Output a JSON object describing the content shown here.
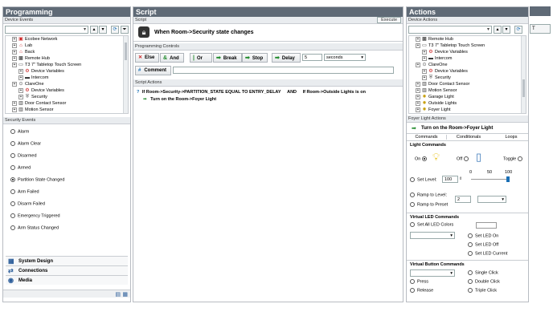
{
  "left": {
    "title": "Programming",
    "device_events_header": "Device Events",
    "tree": [
      {
        "label": "Ecobee Network",
        "icon": "network-icon",
        "depth": 1
      },
      {
        "label": "Lab",
        "icon": "room-icon",
        "depth": 1
      },
      {
        "label": "Back",
        "icon": "room-icon",
        "depth": 1
      },
      {
        "label": "Remote Hub",
        "icon": "remote-icon",
        "depth": 1
      },
      {
        "label": "T3 7\" Tabletop Touch Screen",
        "icon": "touchscreen-icon",
        "depth": 1
      },
      {
        "label": "Device Variables",
        "icon": "variables-icon",
        "depth": 2
      },
      {
        "label": "Intercom",
        "icon": "intercom-icon",
        "depth": 2
      },
      {
        "label": "ClareOne",
        "icon": "lock-icon",
        "depth": 1
      },
      {
        "label": "Device Variables",
        "icon": "variables-icon",
        "depth": 2
      },
      {
        "label": "Security",
        "icon": "security-icon",
        "depth": 2
      },
      {
        "label": "Door Contact Sensor",
        "icon": "sensor-icon",
        "depth": 1
      },
      {
        "label": "Motion Sensor",
        "icon": "sensor-icon",
        "depth": 1
      }
    ],
    "security_events_header": "Security Events",
    "events": [
      "Alarm",
      "Alarm Clear",
      "Disarmed",
      "Armed",
      "Partition State Changed",
      "Arm Failed",
      "Disarm Failed",
      "Emergency Triggered",
      "Arm Status Changed"
    ],
    "selected_event": 4,
    "nav": [
      "System Design",
      "Connections",
      "Media"
    ]
  },
  "mid": {
    "title": "Script",
    "script_header": "Script",
    "execute": "Execute",
    "script_title": "When Room->Security state changes",
    "controls_header": "Programming Controls",
    "controls": {
      "else": "Else",
      "and": "And",
      "or": "Or",
      "break": "Break",
      "stop": "Stop",
      "delay": "Delay",
      "delay_value": "5",
      "delay_unit": "seconds",
      "comment": "Comment"
    },
    "actions_header": "Script Actions",
    "line1_a": "If Room->Security->PARTITION_STATE EQUAL TO ENTRY_DELAY",
    "line1_and": "AND",
    "line1_b": "If Room->Outside Lights is on",
    "line2": "Turn on the Room->Foyer Light"
  },
  "right": {
    "title": "Actions",
    "device_actions_header": "Device Actions",
    "tree": [
      {
        "label": "Remote Hub",
        "icon": "remote-icon",
        "depth": 1
      },
      {
        "label": "T3 7\" Tabletop Touch Screen",
        "icon": "touchscreen-icon",
        "depth": 1
      },
      {
        "label": "Device Variables",
        "icon": "variables-icon",
        "depth": 2
      },
      {
        "label": "Intercom",
        "icon": "intercom-icon",
        "depth": 2
      },
      {
        "label": "ClareOne",
        "icon": "lock-icon",
        "depth": 1
      },
      {
        "label": "Device Variables",
        "icon": "variables-icon",
        "depth": 2
      },
      {
        "label": "Security",
        "icon": "security-icon",
        "depth": 2
      },
      {
        "label": "Door Contact Sensor",
        "icon": "sensor-icon",
        "depth": 1
      },
      {
        "label": "Motion Sensor",
        "icon": "sensor-icon",
        "depth": 1
      },
      {
        "label": "Garage Light",
        "icon": "light-icon",
        "depth": 1
      },
      {
        "label": "Outside Lights",
        "icon": "light-icon",
        "depth": 1
      },
      {
        "label": "Foyer Light",
        "icon": "light-icon",
        "depth": 1
      }
    ],
    "foyer_header": "Foyer Light Actions",
    "foyer_title": "Turn on the Room->Foyer Light",
    "tabs": [
      "Commands",
      "Conditionals",
      "Loops"
    ],
    "light_commands": "Light Commands",
    "on": "On",
    "off": "Off",
    "toggle": "Toggle",
    "set_level": "Set Level:",
    "level_value": "100",
    "slider_ticks": [
      "0",
      "50",
      "100"
    ],
    "slider_value": 100,
    "ramp_level": "Ramp to Level:",
    "ramp_preset": "Ramp to Preset",
    "preset_value": "2",
    "virtual_led": "Virtual LED Commands",
    "set_all_led": "Set All LED Colors",
    "set_led_on": "Set LED On",
    "set_led_off": "Set LED Off",
    "set_led_current": "Set LED Current",
    "virtual_button": "Virtual Button Commands",
    "press": "Press",
    "release": "Release",
    "single_click": "Single Click",
    "double_click": "Double Click",
    "triple_click": "Triple Click"
  },
  "colors": {
    "header": "#5f6a76",
    "accent_green": "#1f8a2a",
    "selected": "#cfe3f7"
  }
}
